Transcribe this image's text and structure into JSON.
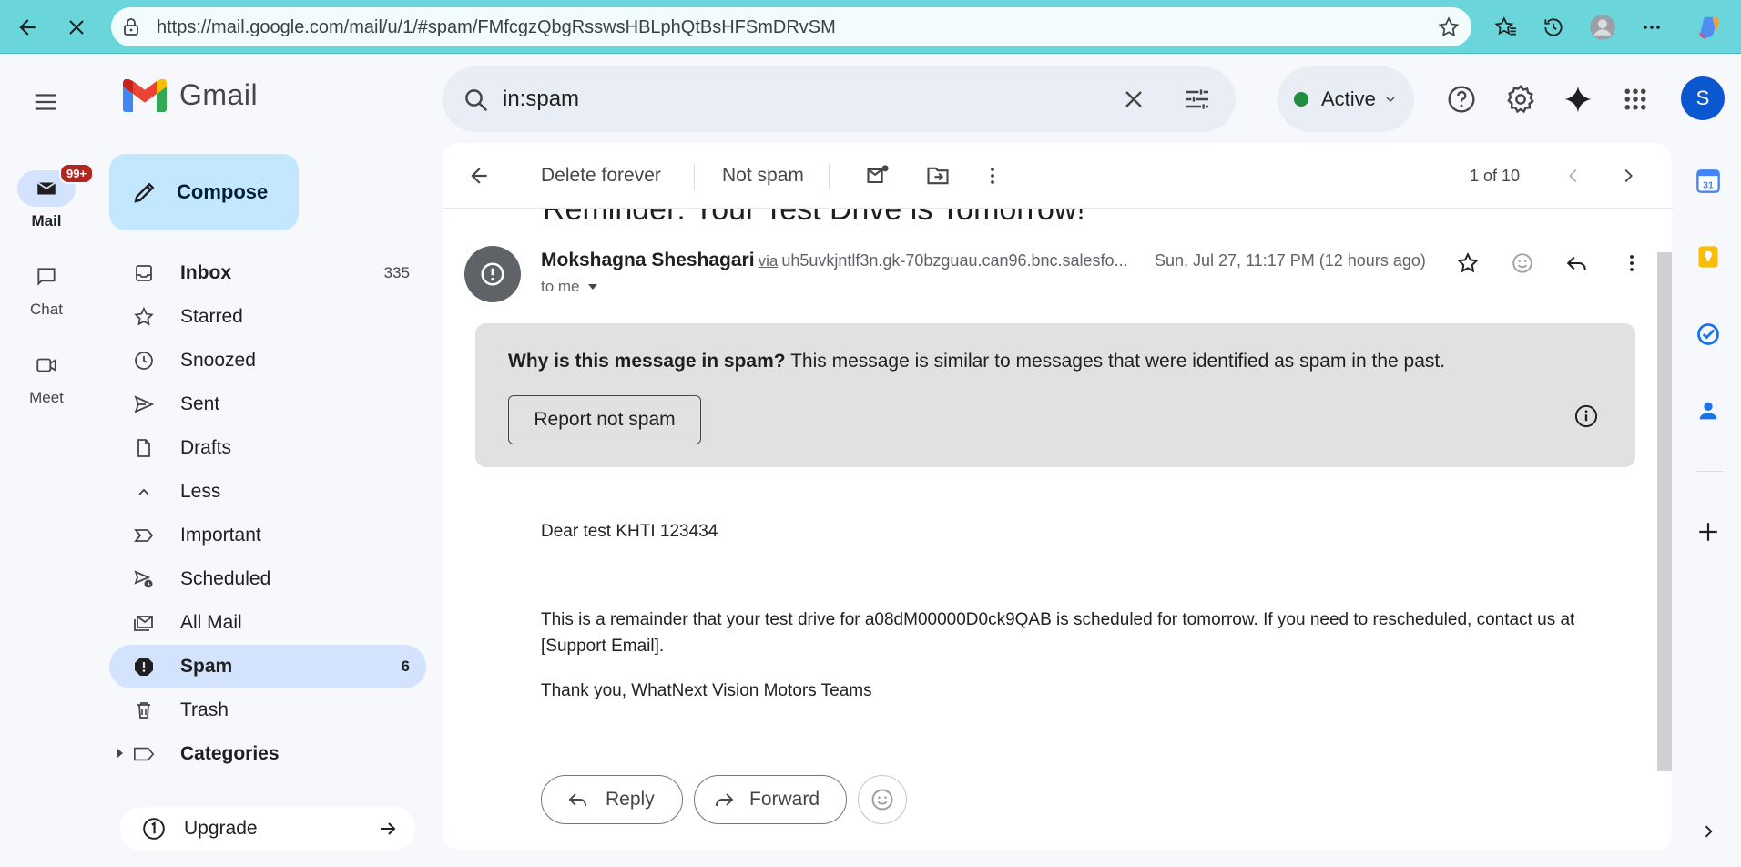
{
  "browser": {
    "url": "https://mail.google.com/mail/u/1/#spam/FMfcgzQbgRsswsHBLphQtBsHFSmDRvSM"
  },
  "rail": {
    "mail_label": "Mail",
    "mail_badge": "99+",
    "chat_label": "Chat",
    "meet_label": "Meet"
  },
  "app": {
    "name": "Gmail",
    "compose_label": "Compose",
    "upgrade_label": "Upgrade"
  },
  "nav": [
    {
      "label": "Inbox",
      "count": "335",
      "icon": "inbox-icon"
    },
    {
      "label": "Starred",
      "count": "",
      "icon": "star-icon"
    },
    {
      "label": "Snoozed",
      "count": "",
      "icon": "clock-icon"
    },
    {
      "label": "Sent",
      "count": "",
      "icon": "send-icon"
    },
    {
      "label": "Drafts",
      "count": "",
      "icon": "draft-icon"
    },
    {
      "label": "Less",
      "count": "",
      "icon": "chevron-up-icon"
    },
    {
      "label": "Important",
      "count": "",
      "icon": "important-icon"
    },
    {
      "label": "Scheduled",
      "count": "",
      "icon": "scheduled-icon"
    },
    {
      "label": "All Mail",
      "count": "",
      "icon": "all-mail-icon"
    },
    {
      "label": "Spam",
      "count": "6",
      "icon": "spam-icon"
    },
    {
      "label": "Trash",
      "count": "",
      "icon": "trash-icon"
    },
    {
      "label": "Categories",
      "count": "",
      "icon": "label-icon"
    }
  ],
  "search": {
    "query": "in:spam"
  },
  "status": {
    "label": "Active",
    "color": "#1e8e3e"
  },
  "user": {
    "initial": "S"
  },
  "toolbar": {
    "delete_forever": "Delete forever",
    "not_spam": "Not spam",
    "pagination": "1 of 10"
  },
  "email": {
    "subject": "Reminder: Your Test Drive is Tomorrow!",
    "sender_name": "Mokshagna Sheshagari",
    "via": "via",
    "via_address": "uh5uvkjntlf3n.gk-70bzguau.can96.bnc.salesfo...",
    "date": "Sun, Jul 27, 11:17 PM (12 hours ago)",
    "to": "to me",
    "spam_why_title": "Why is this message in spam?",
    "spam_why_text": "This message is similar to messages that were identified as spam in the past.",
    "report_not_spam": "Report not spam",
    "greeting": "Dear test KHTI 123434",
    "body_para": "This is a remainder that your test drive for a08dM00000D0ck9QAB is scheduled for tomorrow. If you need to rescheduled, contact us at [Support Email].",
    "signoff": "Thank you, WhatNext Vision Motors Teams",
    "reply_label": "Reply",
    "forward_label": "Forward"
  },
  "colors": {
    "browser_bar": "#6ad6dc",
    "compose_bg": "#c2e7ff",
    "active_nav": "#d3e3fd",
    "badge": "#b3261e",
    "avatar": "#0b57d0"
  }
}
